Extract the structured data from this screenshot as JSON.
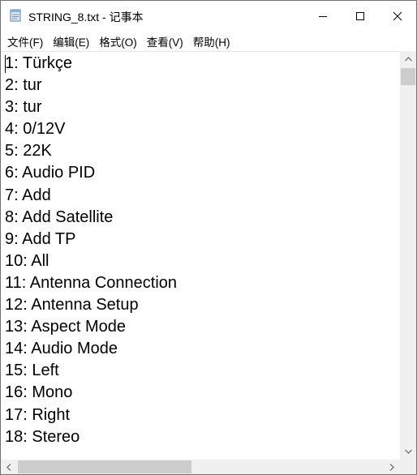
{
  "window": {
    "title": "STRING_8.txt - 记事本",
    "icon": "notepad-icon",
    "controls": {
      "minimize_icon": "minimize-icon",
      "maximize_icon": "maximize-icon",
      "close_icon": "close-icon"
    }
  },
  "menu": [
    {
      "label": "文件(F)"
    },
    {
      "label": "编辑(E)"
    },
    {
      "label": "格式(O)"
    },
    {
      "label": "查看(V)"
    },
    {
      "label": "帮助(H)"
    }
  ],
  "editor": {
    "lines": [
      "1: Türkçe",
      "2: tur",
      "3: tur",
      "4: 0/12V",
      "5: 22K",
      "6: Audio PID",
      "7: Add",
      "8: Add Satellite",
      "9: Add TP",
      "10: All",
      "11: Antenna Connection",
      "12: Antenna Setup",
      "13: Aspect Mode",
      "14: Audio Mode",
      "15: Left",
      "16: Mono",
      "17: Right",
      "18: Stereo"
    ]
  },
  "colors": {
    "scrollbar_track": "#f0f0f0",
    "scrollbar_thumb": "#cdcdcd",
    "text": "#000000"
  }
}
